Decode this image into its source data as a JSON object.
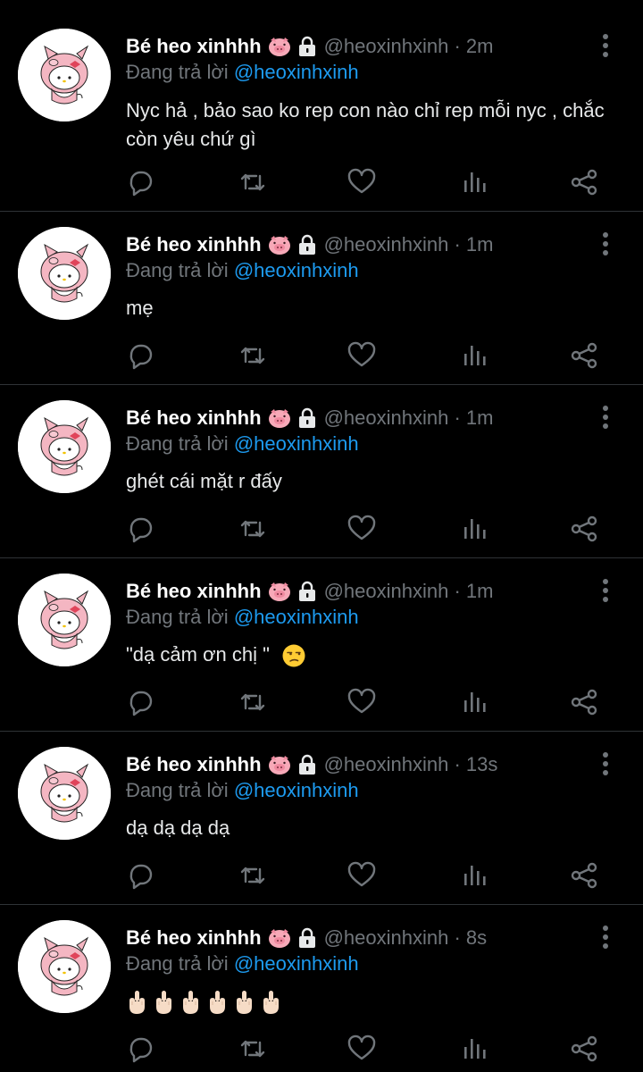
{
  "colors": {
    "background": "#000000",
    "divider": "#2f3336",
    "name": "#ffffff",
    "secondary": "#71767b",
    "mention": "#1d9bf0",
    "text": "#e7e9ea"
  },
  "tweets": [
    {
      "name": "Bé heo xinhhh",
      "handle": "@heoxinhxinh",
      "time": "· 2m",
      "replying_prefix": "Đang trả lời",
      "replying_to": "@heoxinhxinh",
      "text": "Nyc hả ,  bảo sao ko rep con nào chỉ rep mỗi nyc , chắc còn yêu chứ gì"
    },
    {
      "name": "Bé heo xinhhh",
      "handle": "@heoxinhxinh",
      "time": "· 1m",
      "replying_prefix": "Đang trả lời",
      "replying_to": "@heoxinhxinh",
      "text": "mẹ"
    },
    {
      "name": "Bé heo xinhhh",
      "handle": "@heoxinhxinh",
      "time": "· 1m",
      "replying_prefix": "Đang trả lời",
      "replying_to": "@heoxinhxinh",
      "text": "ghét cái mặt r đấy"
    },
    {
      "name": "Bé heo xinhhh",
      "handle": "@heoxinhxinh",
      "time": "· 1m",
      "replying_prefix": "Đang trả lời",
      "replying_to": "@heoxinhxinh",
      "text": "\"dạ cảm ơn chị \"",
      "emoji": "unamused-face"
    },
    {
      "name": "Bé heo xinhhh",
      "handle": "@heoxinhxinh",
      "time": "· 13s",
      "replying_prefix": "Đang trả lời",
      "replying_to": "@heoxinhxinh",
      "text": "dạ dạ dạ dạ"
    },
    {
      "name": "Bé heo xinhhh",
      "handle": "@heoxinhxinh",
      "time": "· 8s",
      "replying_prefix": "Đang trả lời",
      "replying_to": "@heoxinhxinh",
      "text": "",
      "emoji": "middle-finger x6"
    }
  ],
  "icons": {
    "avatar": "pig-costume-kitty-avatar",
    "badge": "pig-face-emoji",
    "lock": "lock-icon",
    "more": "more-vertical-icon",
    "actions": [
      "reply-icon",
      "retweet-icon",
      "like-icon",
      "analytics-icon",
      "share-icon"
    ]
  }
}
